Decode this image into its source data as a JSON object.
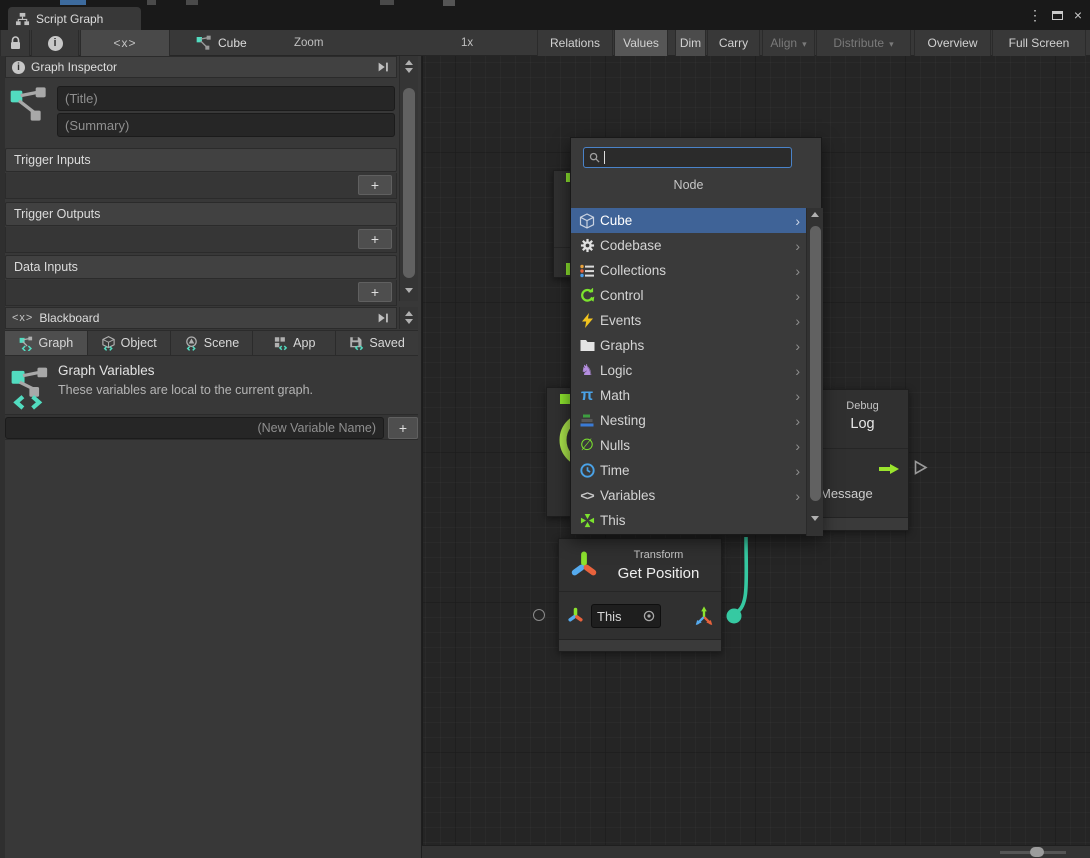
{
  "window": {
    "title": "Script Graph"
  },
  "toolbar": {
    "graph_name": "Cube",
    "zoom_label": "Zoom",
    "zoom_value": "1x",
    "buttons": [
      {
        "label": "Relations",
        "state": "normal"
      },
      {
        "label": "Values",
        "state": "active"
      },
      {
        "label": "Dim",
        "state": "active"
      },
      {
        "label": "Carry",
        "state": "normal"
      },
      {
        "label": "Align",
        "state": "disabled"
      },
      {
        "label": "Distribute",
        "state": "disabled"
      },
      {
        "label": "Overview",
        "state": "normal"
      },
      {
        "label": "Full Screen",
        "state": "normal"
      }
    ]
  },
  "inspector": {
    "title": "Graph Inspector",
    "title_placeholder": "(Title)",
    "summary_placeholder": "(Summary)",
    "sections": [
      "Trigger Inputs",
      "Trigger Outputs",
      "Data Inputs"
    ],
    "add_label": "+"
  },
  "blackboard": {
    "title": "Blackboard",
    "tabs": [
      "Graph",
      "Object",
      "Scene",
      "App",
      "Saved"
    ],
    "active_tab": "Graph",
    "heading": "Graph Variables",
    "description": "These variables are local to the current graph.",
    "new_variable_placeholder": "(New Variable Name)",
    "add_label": "+"
  },
  "finder": {
    "search_value": "",
    "header": "Node",
    "items": [
      {
        "label": "Cube",
        "icon": "cube-icon",
        "selected": true,
        "has_children": true
      },
      {
        "label": "Codebase",
        "icon": "gear-icon",
        "selected": false,
        "has_children": true
      },
      {
        "label": "Collections",
        "icon": "list-icon",
        "selected": false,
        "has_children": true
      },
      {
        "label": "Control",
        "icon": "control-icon",
        "selected": false,
        "has_children": true
      },
      {
        "label": "Events",
        "icon": "lightning-icon",
        "selected": false,
        "has_children": true
      },
      {
        "label": "Graphs",
        "icon": "folder-icon",
        "selected": false,
        "has_children": true
      },
      {
        "label": "Logic",
        "icon": "knight-icon",
        "selected": false,
        "has_children": true
      },
      {
        "label": "Math",
        "icon": "pi-icon",
        "selected": false,
        "has_children": true
      },
      {
        "label": "Nesting",
        "icon": "nesting-icon",
        "selected": false,
        "has_children": true
      },
      {
        "label": "Nulls",
        "icon": "null-icon",
        "selected": false,
        "has_children": true
      },
      {
        "label": "Time",
        "icon": "clock-icon",
        "selected": false,
        "has_children": true
      },
      {
        "label": "Variables",
        "icon": "brackets-icon",
        "selected": false,
        "has_children": true
      },
      {
        "label": "This",
        "icon": "converge-icon",
        "selected": false,
        "has_children": false
      }
    ]
  },
  "nodes": {
    "debug_log": {
      "category": "Debug",
      "name": "Log",
      "input_label": "Message"
    },
    "get_position": {
      "category": "Transform",
      "name": "Get Position",
      "value_field": "This"
    }
  },
  "colors": {
    "accent_teal": "#52dcc0",
    "wire_teal": "#36c9a2",
    "trigger_green": "#8ce32e",
    "selection_blue": "#3f6397",
    "panel_bg": "#383838",
    "canvas_bg": "#252525"
  }
}
